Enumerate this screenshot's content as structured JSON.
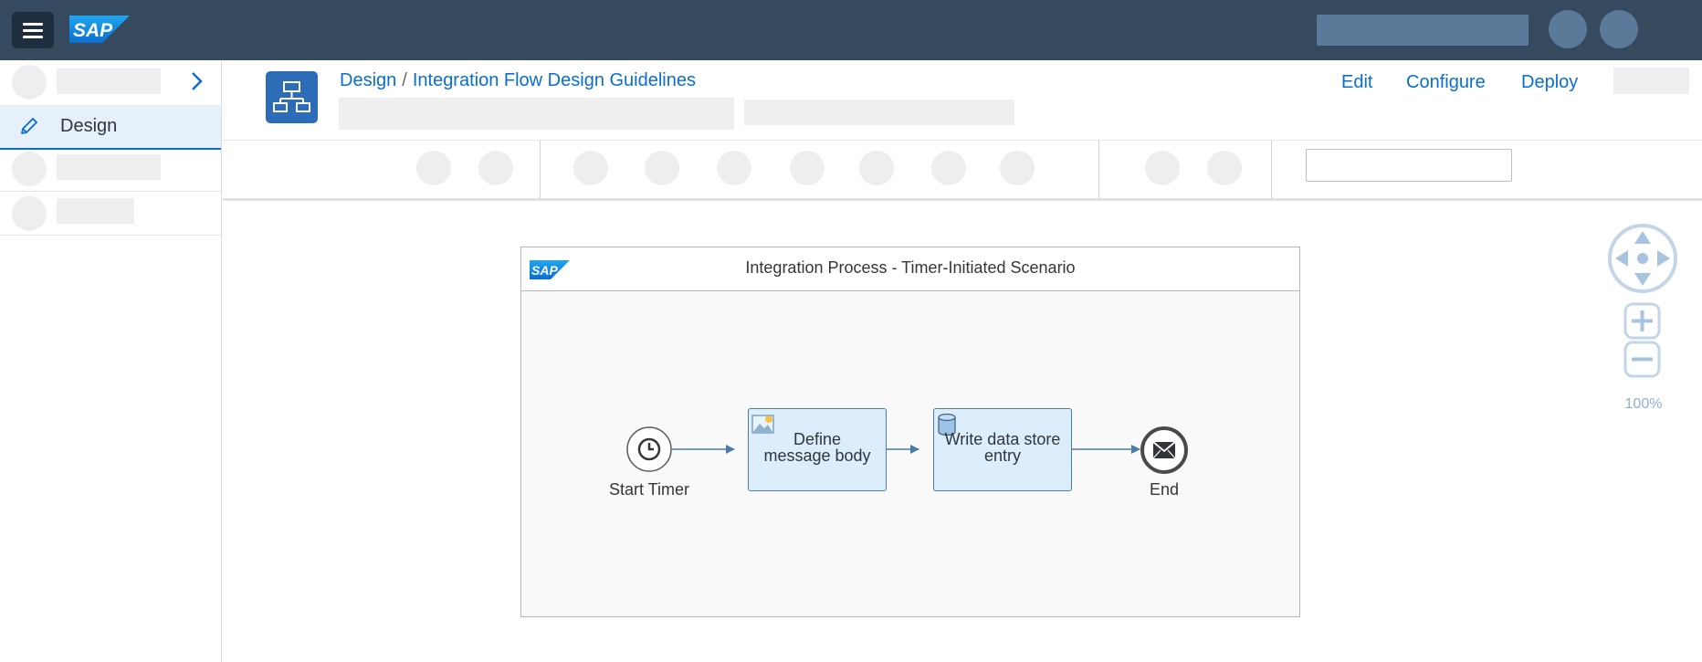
{
  "breadcrumb": {
    "root": "Design",
    "separator": "/",
    "current": "Integration Flow Design Guidelines"
  },
  "sidebar": {
    "active_item": "Design"
  },
  "header_actions": {
    "edit": "Edit",
    "configure": "Configure",
    "deploy": "Deploy"
  },
  "process": {
    "title": "Integration Process - Timer-Initiated Scenario",
    "start_label": "Start Timer",
    "step1_line1": "Define",
    "step1_line2": "message body",
    "step2_line1": "Write data store",
    "step2_line2": "entry",
    "end_label": "End"
  },
  "navigation": {
    "zoom_level": "100%"
  },
  "colors": {
    "shell": "#354a5f",
    "accent": "#0a6ed1",
    "task_fill": "#dceefb",
    "flow_line": "#4a7bab"
  }
}
